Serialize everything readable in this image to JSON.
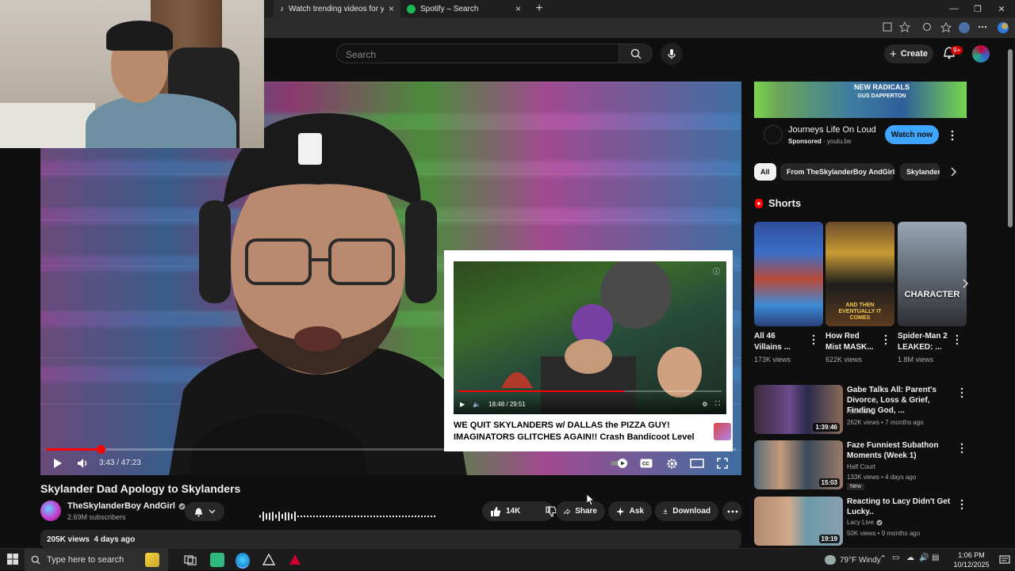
{
  "browser": {
    "tabs": [
      {
        "label": "Watch trending videos for you | T",
        "icon": "tiktok-icon"
      },
      {
        "label": "Spotify – Search",
        "icon": "spotify-icon"
      }
    ],
    "new_tab_label": "+",
    "window_controls": [
      "minimize-icon",
      "restore-icon",
      "close-icon"
    ]
  },
  "header": {
    "search_placeholder": "Search",
    "create_label": "Create",
    "notification_count": "9+"
  },
  "player": {
    "time_display": "3:43 / 47:23",
    "progress_fraction": 0.079,
    "endscreen": {
      "title": "WE QUIT SKYLANDERS w/ DALLAS the PIZZA GUY! IMAGINATORS GLITCHES AGAIN!! Crash Bandicoot Level",
      "time_display": "18:48 / 29:51",
      "progress_fraction": 0.63
    }
  },
  "video": {
    "title": "Skylander Dad Apology to Skylanders",
    "channel": "TheSkylanderBoy AndGirl",
    "subscribers": "2.69M subscribers",
    "likes": "14K",
    "share_label": "Share",
    "ask_label": "Ask",
    "download_label": "Download",
    "views": "205K views",
    "age": "4 days ago"
  },
  "sidebar": {
    "ad": {
      "banner_text": "NEW RADICALS",
      "banner_subtext": "GUS DAPPERTON",
      "title": "Journeys Life On Loud",
      "sponsored": "Sponsored",
      "domain": "youtu.be",
      "cta": "Watch now"
    },
    "chips": [
      "All",
      "From TheSkylanderBoy AndGirl",
      "Skylander"
    ],
    "shorts_header": "Shorts",
    "shorts": [
      {
        "title": "All 46 Villains ...",
        "views": "173K views",
        "overlay": ""
      },
      {
        "title": "How Red Mist MASK...",
        "views": "622K views",
        "overlay": "AND THEN EVENTUALLY IT COMES"
      },
      {
        "title": "Spider-Man 2 LEAKED: ...",
        "views": "1.8M views",
        "overlay": "CHARACTER"
      }
    ],
    "recommended": [
      {
        "title": "Gabe Talks All: Parent's Divorce, Loss & Grief, Finding God, ...",
        "channel": "Alannized",
        "meta": "262K views • 7 months ago",
        "duration": "1:39:46",
        "badge": ""
      },
      {
        "title": "Faze Funniest Subathon Moments (Week 1)",
        "channel": "Half Court",
        "meta": "133K views • 4 days ago",
        "duration": "15:03",
        "badge": "New"
      },
      {
        "title": "Reacting to Lacy Didn't Get Lucky..",
        "channel": "Lacy Live",
        "meta": "50K views • 9 months ago",
        "duration": "19:19",
        "badge": ""
      }
    ]
  },
  "taskbar": {
    "search_placeholder": "Type here to search",
    "weather": "79°F  Windy",
    "time": "1:06 PM",
    "date": "10/12/2025"
  },
  "colors": {
    "background": "#0f0f0f",
    "accent_red": "#ff0000",
    "cta_blue": "#3ea6ff"
  }
}
